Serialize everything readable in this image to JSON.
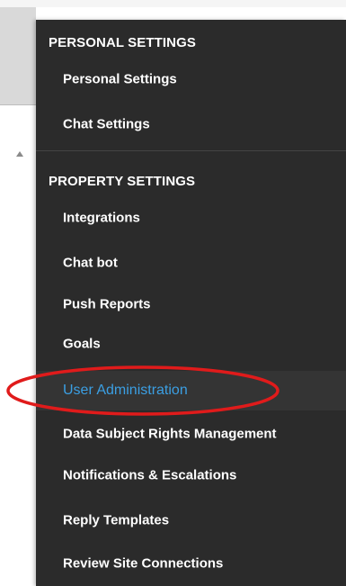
{
  "menu": {
    "personal_header": "PERSONAL SETTINGS",
    "personal_items": [
      {
        "label": "Personal Settings"
      },
      {
        "label": "Chat Settings"
      }
    ],
    "property_header": "PROPERTY SETTINGS",
    "property_items": [
      {
        "label": "Integrations"
      },
      {
        "label": "Chat bot"
      },
      {
        "label": "Push Reports"
      },
      {
        "label": "Goals"
      },
      {
        "label": "User Administration",
        "active": true
      },
      {
        "label": "Data Subject Rights Management"
      },
      {
        "label": "Notifications & Escalations"
      },
      {
        "label": "Reply Templates"
      },
      {
        "label": "Review Site Connections"
      }
    ]
  },
  "colors": {
    "menu_background": "#2b2b2b",
    "active_item_text": "#3b9fe3",
    "annotation": "#e01b1b"
  }
}
